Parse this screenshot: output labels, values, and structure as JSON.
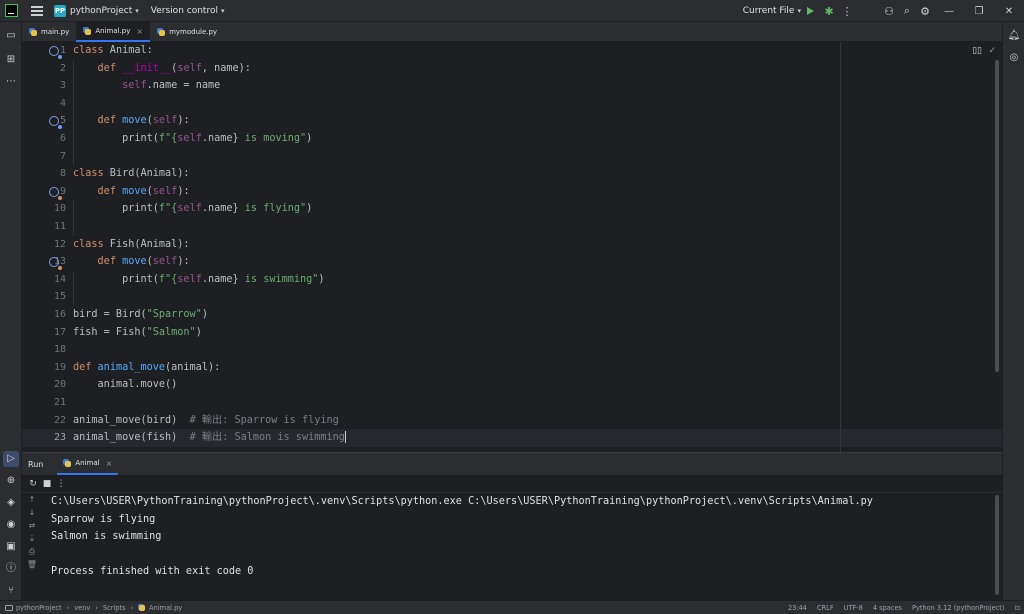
{
  "titlebar": {
    "project_badge": "PP",
    "project_name": "pythonProject",
    "vcs_label": "Version control",
    "run_config": "Current File"
  },
  "tabs": [
    {
      "label": "main.py",
      "active": false
    },
    {
      "label": "Animal.py",
      "active": true
    },
    {
      "label": "mymodule.py",
      "active": false
    }
  ],
  "editor": {
    "lines": [
      {
        "n": "1"
      },
      {
        "n": "2"
      },
      {
        "n": "3"
      },
      {
        "n": "4"
      },
      {
        "n": "5"
      },
      {
        "n": "6"
      },
      {
        "n": "7"
      },
      {
        "n": "8"
      },
      {
        "n": "9"
      },
      {
        "n": "10"
      },
      {
        "n": "11"
      },
      {
        "n": "12"
      },
      {
        "n": "13"
      },
      {
        "n": "14"
      },
      {
        "n": "15"
      },
      {
        "n": "16"
      },
      {
        "n": "17"
      },
      {
        "n": "18"
      },
      {
        "n": "19"
      },
      {
        "n": "20"
      },
      {
        "n": "21"
      },
      {
        "n": "22"
      },
      {
        "n": "23"
      }
    ],
    "code": {
      "l1_kw": "class",
      "l1_rest": " Animal:",
      "l2_kw": "def",
      "l2_fn": "__init__",
      "l2_open": "(",
      "l2_self": "self",
      "l2_rest": ", name):",
      "l3_self": "self",
      "l3_rest": ".name = name",
      "l5_kw": "def",
      "l5_fn": "move",
      "l5_open": "(",
      "l5_self": "self",
      "l5_rest": "):",
      "l6_print": "print(",
      "l6_fq": "f\"{",
      "l6_self": "self",
      "l6_mid": ".name}",
      "l6_str": " is moving\"",
      "l6_close": ")",
      "l8_kw": "class",
      "l8_rest": " Bird(Animal):",
      "l9_kw": "def",
      "l9_fn": "move",
      "l9_open": "(",
      "l9_self": "self",
      "l9_rest": "):",
      "l10_print": "print(",
      "l10_fq": "f\"{",
      "l10_self": "self",
      "l10_mid": ".name}",
      "l10_str": " is flying\"",
      "l10_close": ")",
      "l12_kw": "class",
      "l12_rest": " Fish(Animal):",
      "l13_kw": "def",
      "l13_fn": "move",
      "l13_open": "(",
      "l13_self": "self",
      "l13_rest": "):",
      "l14_print": "print(",
      "l14_fq": "f\"{",
      "l14_self": "self",
      "l14_mid": ".name}",
      "l14_str": " is swimming\"",
      "l14_close": ")",
      "l16_a": "bird = Bird(",
      "l16_str": "\"Sparrow\"",
      "l16_b": ")",
      "l17_a": "fish = Fish(",
      "l17_str": "\"Salmon\"",
      "l17_b": ")",
      "l19_kw": "def",
      "l19_fn": "animal_move",
      "l19_rest": "(animal):",
      "l20": "animal.move()",
      "l22_code": "animal_move(bird)",
      "l22_cm": "# 輸出: Sparrow is flying",
      "l23_code": "animal_move(fish)",
      "l23_cm": "# 輸出: Salmon is swimming"
    }
  },
  "run_panel": {
    "title": "Run",
    "tab_label": "Animal",
    "output": [
      "C:\\Users\\USER\\PythonTraining\\pythonProject\\.venv\\Scripts\\python.exe C:\\Users\\USER\\PythonTraining\\pythonProject\\.venv\\Scripts\\Animal.py",
      "Sparrow is flying",
      "Salmon is swimming",
      "",
      "Process finished with exit code 0"
    ]
  },
  "statusbar": {
    "breadcrumbs": [
      "pythonProject",
      "venv",
      "Scripts",
      "Animal.py"
    ],
    "position": "23:44",
    "line_sep": "CRLF",
    "encoding": "UTF-8",
    "indent": "4 spaces",
    "interpreter": "Python 3.12 (pythonProject)"
  }
}
